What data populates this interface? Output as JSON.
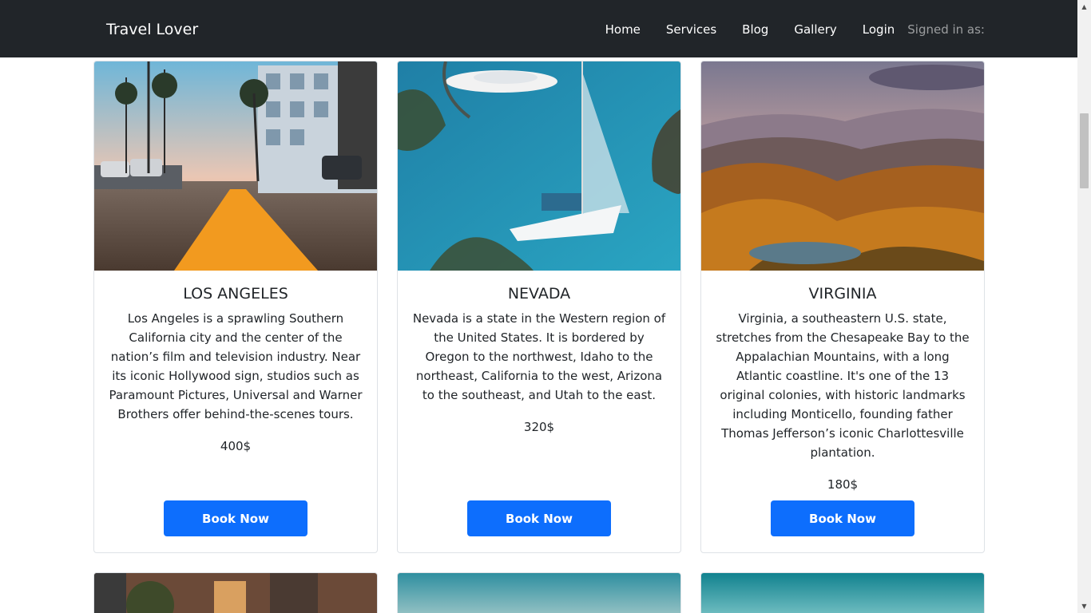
{
  "navbar": {
    "brand": "Travel Lover",
    "links": [
      "Home",
      "Services",
      "Blog",
      "Gallery",
      "Login"
    ],
    "signed_in": "Signed in as:"
  },
  "cards": [
    {
      "title": "LOS ANGELES",
      "description": "Los Angeles is a sprawling Southern California city and the center of the nation’s film and television industry. Near its iconic Hollywood sign, studios such as Paramount Pictures, Universal and Warner Brothers offer behind-the-scenes tours.",
      "price": "400$",
      "button": "Book Now"
    },
    {
      "title": "NEVADA",
      "description": "Nevada is a state in the Western region of the United States. It is bordered by Oregon to the northwest, Idaho to the northeast, California to the west, Arizona to the southeast, and Utah to the east.",
      "price": "320$",
      "button": "Book Now"
    },
    {
      "title": "VIRGINIA",
      "description": "Virginia, a southeastern U.S. state, stretches from the Chesapeake Bay to the Appalachian Mountains, with a long Atlantic coastline. It's one of the 13 original colonies, with historic landmarks including Monticello, founding father Thomas Jefferson’s iconic Charlottesville plantation.",
      "price": "180$",
      "button": "Book Now"
    }
  ],
  "colors": {
    "navbar_bg": "#212529",
    "button_bg": "#0d6efd",
    "card_border": "#dee2e6"
  }
}
